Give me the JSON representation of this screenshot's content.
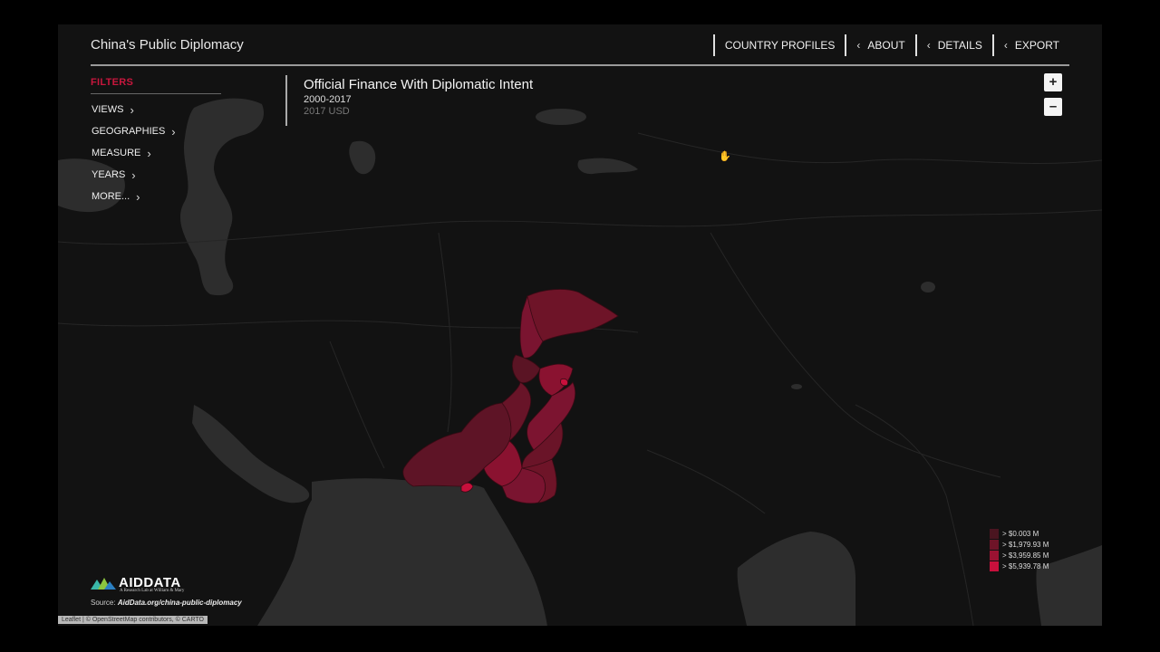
{
  "header": {
    "title": "China's Public Diplomacy",
    "nav": [
      {
        "label": "COUNTRY PROFILES",
        "chevron": false
      },
      {
        "label": "ABOUT",
        "chevron": true
      },
      {
        "label": "DETAILS",
        "chevron": true
      },
      {
        "label": "EXPORT",
        "chevron": true
      }
    ]
  },
  "filters": {
    "title": "FILTERS",
    "items": [
      "VIEWS",
      "GEOGRAPHIES",
      "MEASURE",
      "YEARS",
      "MORE..."
    ]
  },
  "map": {
    "title": "Official Finance With Diplomatic Intent",
    "years": "2000-2017",
    "unit": "2017 USD"
  },
  "zoom": {
    "in_label": "+",
    "out_label": "–"
  },
  "legend": [
    {
      "label": "> $0.003 M",
      "color": "#4a1520"
    },
    {
      "label": "> $1,979.93 M",
      "color": "#6e1428"
    },
    {
      "label": "> $3,959.85 M",
      "color": "#9a1232"
    },
    {
      "label": "> $5,939.78 M",
      "color": "#c8103c"
    }
  ],
  "branding": {
    "logo_text": "AIDDATA",
    "logo_sub": "A Research Lab at William & Mary",
    "source_prefix": "Source:",
    "source_link": "AidData.org/china-public-diplomacy"
  },
  "attribution": "Leaflet | © OpenStreetMap contributors, © CARTO",
  "colors": {
    "accent": "#c8173d",
    "land": "#121212",
    "water": "#2d2d2d",
    "border": "#262626"
  }
}
